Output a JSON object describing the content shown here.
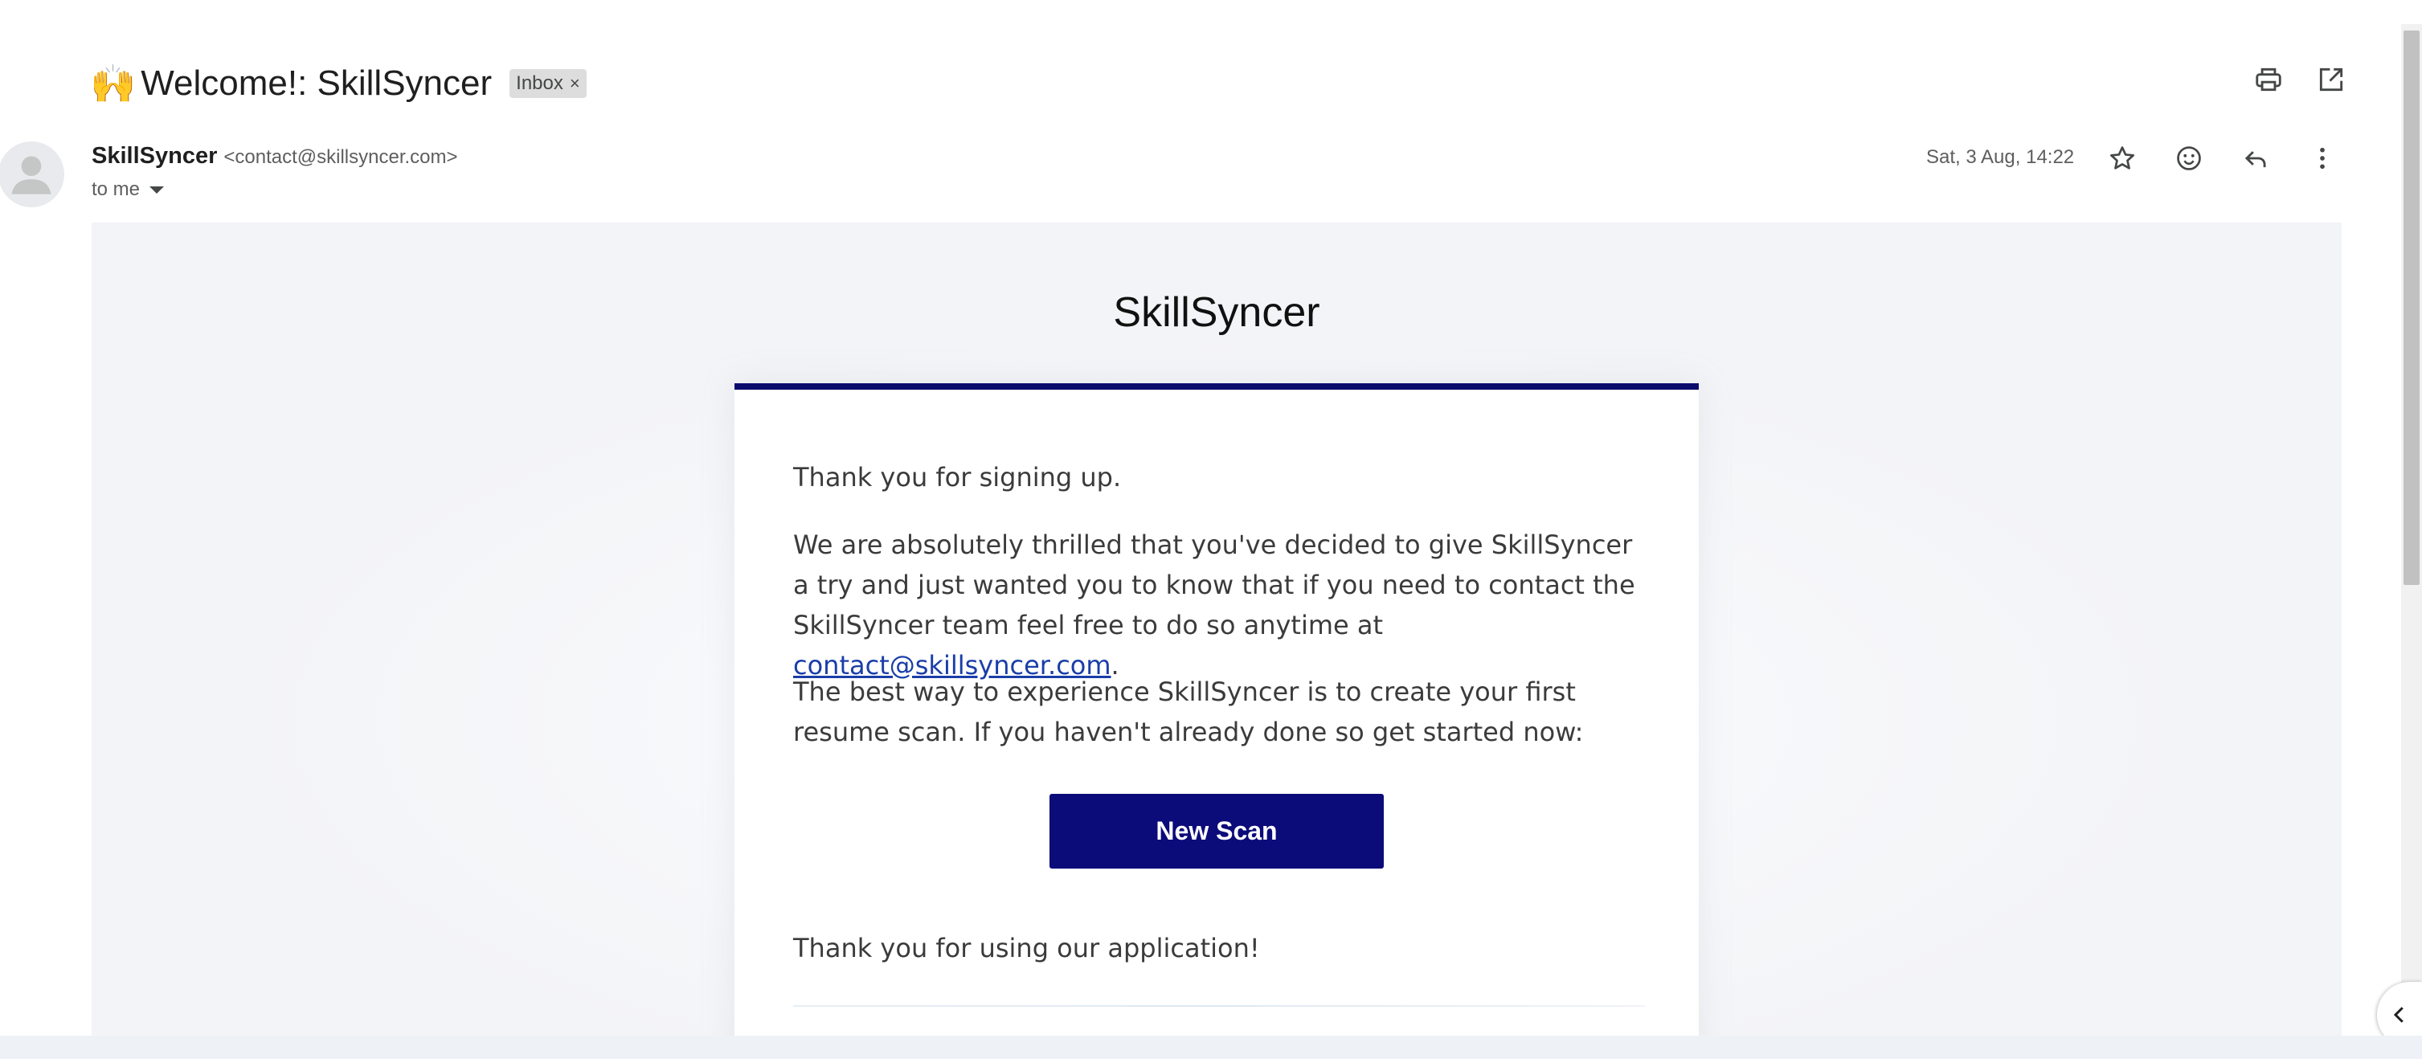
{
  "subject": {
    "emoji": "🙌",
    "title": "Welcome!: SkillSyncer",
    "label": "Inbox",
    "label_remove": "×"
  },
  "top_actions": [
    {
      "icon": "print-icon"
    },
    {
      "icon": "open-in-new-window-icon"
    }
  ],
  "sender": {
    "name": "SkillSyncer",
    "email": "<contact@skillsyncer.com>",
    "to": "to me",
    "date": "Sat, 3 Aug, 14:22"
  },
  "message_actions": [
    {
      "icon": "star-icon"
    },
    {
      "icon": "emoji-reaction-icon"
    },
    {
      "icon": "reply-icon"
    },
    {
      "icon": "more-vertical-icon"
    }
  ],
  "email_body": {
    "brand": "SkillSyncer",
    "greeting": "Thank you for signing up.",
    "paragraph2_before": "We are absolutely thrilled that you've decided to give SkillSyncer a try and just wanted you to know that if you need to contact the SkillSyncer team feel free to do so anytime at ",
    "contact_link": "contact@skillsyncer.com",
    "paragraph2_after": ".",
    "paragraph3": "The best way to experience SkillSyncer is to create your first resume scan. If you haven't already done so get started now:",
    "cta_label": "New Scan",
    "closing": "Thank you for using our application!",
    "accent_color": "#0b0b7a"
  }
}
